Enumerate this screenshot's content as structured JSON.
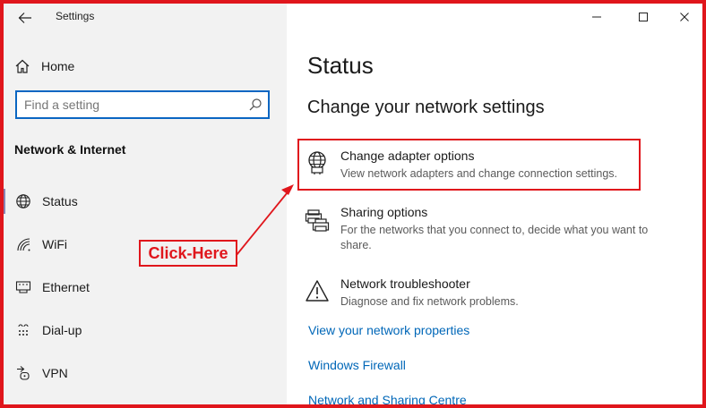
{
  "window": {
    "title": "Settings",
    "controls": [
      "minimize",
      "maximize",
      "close"
    ]
  },
  "sidebar": {
    "home_label": "Home",
    "search": {
      "placeholder": "Find a setting",
      "value": ""
    },
    "section_title": "Network & Internet",
    "items": [
      {
        "label": "Status",
        "icon": "globe-icon",
        "active": true
      },
      {
        "label": "WiFi",
        "icon": "wifi-icon",
        "active": false
      },
      {
        "label": "Ethernet",
        "icon": "ethernet-icon",
        "active": false
      },
      {
        "label": "Dial-up",
        "icon": "dialup-icon",
        "active": false
      },
      {
        "label": "VPN",
        "icon": "vpn-icon",
        "active": false
      }
    ]
  },
  "main": {
    "page_title": "Status",
    "subheading": "Change your network settings",
    "options": [
      {
        "title": "Change adapter options",
        "description": "View network adapters and change connection settings.",
        "icon": "adapter-icon"
      },
      {
        "title": "Sharing options",
        "description": "For the networks that you connect to, decide what you want to share.",
        "icon": "sharing-icon"
      },
      {
        "title": "Network troubleshooter",
        "description": "Diagnose and fix network problems.",
        "icon": "warning-icon"
      }
    ],
    "links": [
      "View your network properties",
      "Windows Firewall",
      "Network and Sharing Centre"
    ]
  },
  "annotation": {
    "callout_text": "Click-Here",
    "color": "#e0161c"
  },
  "colors": {
    "accent": "#0a66c2",
    "link": "#0067b8",
    "sidebar_bg": "#f2f2f2",
    "active_indicator": "#8a84b3"
  }
}
